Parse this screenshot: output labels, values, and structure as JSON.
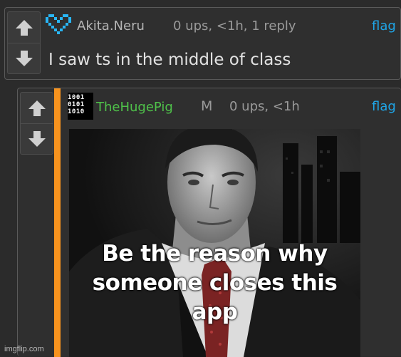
{
  "colors": {
    "accent_link": "#1fa6e8",
    "child_stripe": "#f7931e",
    "username_child": "#4fc24a",
    "username_parent": "#b5b5b5"
  },
  "comments": [
    {
      "username": "Akita.Neru",
      "avatar_icon": "pixel-heart-icon",
      "meta": "0 ups, <1h, 1 reply",
      "flag_label": "flag",
      "body": "I saw ts in the middle of class"
    },
    {
      "username": "TheHugePig",
      "avatar_icon": "binary-digits-icon",
      "avatar_text": [
        "1001",
        "0101",
        "1010"
      ],
      "badge": "M",
      "meta": "0 ups, <1h",
      "flag_label": "flag",
      "meme_caption": [
        "Be the reason why",
        "someone closes this",
        "app"
      ]
    }
  ],
  "watermark": "imgflip.com"
}
